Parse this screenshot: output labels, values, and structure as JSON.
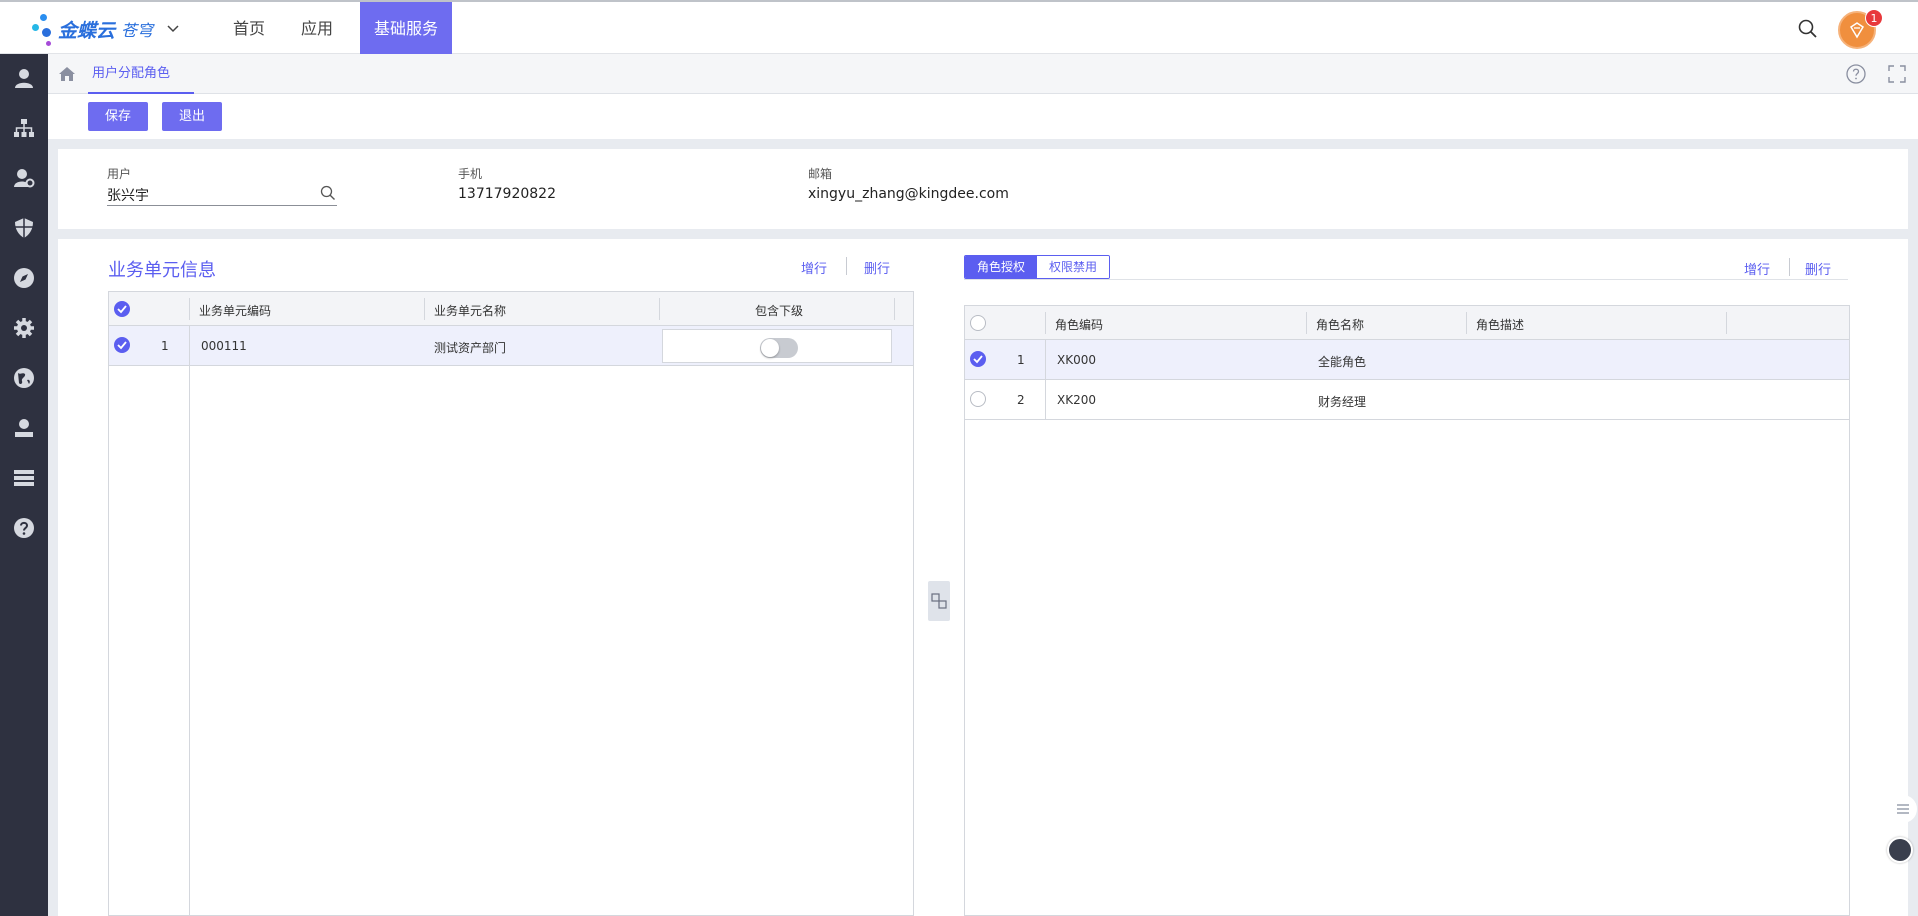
{
  "topbar": {
    "logo_text": "金蝶云",
    "logo_sub": "苍穹",
    "nav": [
      "首页",
      "应用",
      "基础服务"
    ],
    "notification_count": "1"
  },
  "tabbar": {
    "tab_label": "用户分配角色"
  },
  "toolbar": {
    "save_label": "保存",
    "exit_label": "退出"
  },
  "user_info": {
    "user_label": "用户",
    "user_value": "张兴宇",
    "phone_label": "手机",
    "phone_value": "13717920822",
    "email_label": "邮箱",
    "email_value": "xingyu_zhang@kingdee.com"
  },
  "business_unit": {
    "title": "业务单元信息",
    "add_row": "增行",
    "delete_row": "删行",
    "headers": [
      "业务单元编码",
      "业务单元名称",
      "包含下级"
    ],
    "rows": [
      {
        "index": "1",
        "code": "000111",
        "name": "测试资产部门",
        "include_sub": false
      }
    ]
  },
  "roles": {
    "tabs": [
      "角色授权",
      "权限禁用"
    ],
    "add_row": "增行",
    "delete_row": "删行",
    "headers": [
      "角色编码",
      "角色名称",
      "角色描述"
    ],
    "rows": [
      {
        "index": "1",
        "code": "XK000",
        "name": "全能角色",
        "desc": "",
        "selected": true
      },
      {
        "index": "2",
        "code": "XK200",
        "name": "财务经理",
        "desc": "",
        "selected": false
      }
    ]
  },
  "colors": {
    "accent": "#5b5ef0",
    "nav_active": "#6e6cf0",
    "sidebar": "#2e3140"
  }
}
